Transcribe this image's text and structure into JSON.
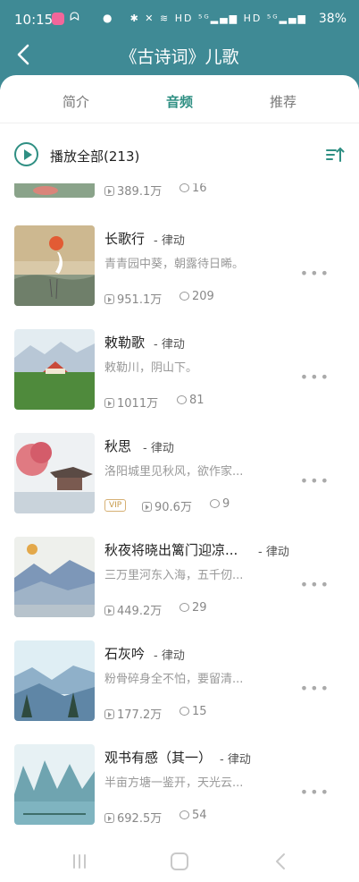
{
  "status": {
    "time": "10:15",
    "battery": "38%",
    "icons": "✱ ✕ ≋ HD ⁵ᴳ▂▄▆ HD ⁵ᴳ▂▄▆"
  },
  "header": {
    "title": "《古诗词》儿歌"
  },
  "tabs": [
    {
      "label": "简介"
    },
    {
      "label": "音频"
    },
    {
      "label": "推荐"
    }
  ],
  "playall": {
    "label": "播放全部(213)"
  },
  "items": [
    {
      "plays": "389.1万",
      "comments": "16"
    },
    {
      "title": "长歌行",
      "author": "- 律动",
      "desc": "青青园中葵，朝露待日晞。",
      "plays": "951.1万",
      "comments": "209"
    },
    {
      "title": "敕勒歌",
      "author": "- 律动",
      "desc": "敕勒川，阴山下。",
      "plays": "1011万",
      "comments": "81"
    },
    {
      "title": "秋思",
      "author": "- 律动",
      "desc": "洛阳城里见秋风，欲作家...",
      "vip": "VIP",
      "plays": "90.6万",
      "comments": "9"
    },
    {
      "title": "秋夜将晓出篱门迎凉...",
      "author": "- 律动",
      "desc": "三万里河东入海，五千仞...",
      "plays": "449.2万",
      "comments": "29"
    },
    {
      "title": "石灰吟",
      "author": "- 律动",
      "desc": "粉骨碎身全不怕，要留清...",
      "plays": "177.2万",
      "comments": "15"
    },
    {
      "title": "观书有感（其一）",
      "author": "- 律动",
      "desc": "半亩方塘一鉴开，天光云...",
      "plays": "692.5万",
      "comments": "54"
    }
  ],
  "colors": {
    "header": "#3f8a95",
    "accent": "#2f8f83"
  },
  "icons": {
    "back": "chevron-left-icon",
    "play": "play-circle-icon",
    "sort": "sort-icon",
    "more": "more-dots-icon"
  }
}
